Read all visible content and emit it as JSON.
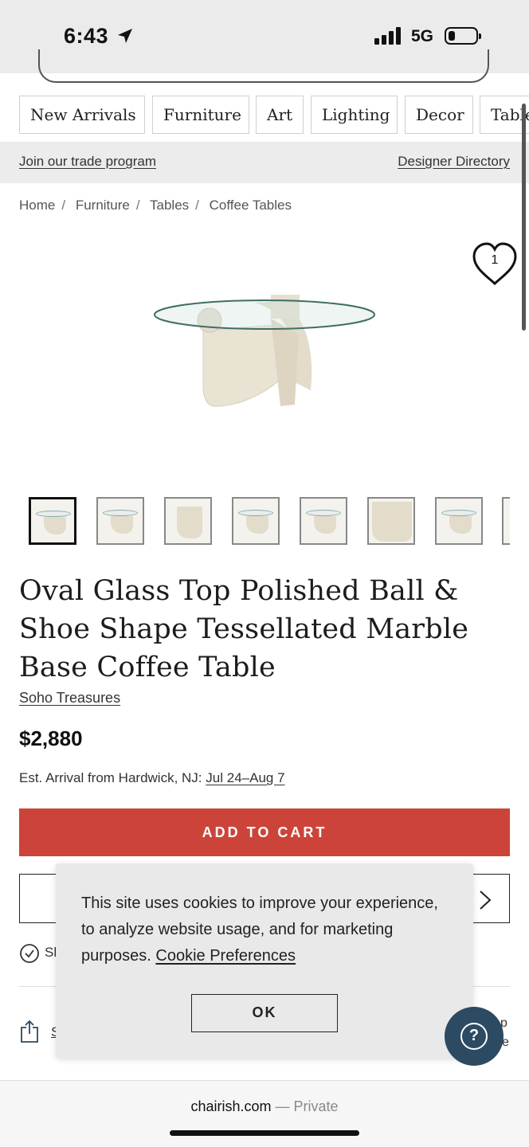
{
  "status_bar": {
    "time": "6:43",
    "network": "5G",
    "battery_fill": 0.2
  },
  "categories": [
    "New Arrivals",
    "Furniture",
    "Art",
    "Lighting",
    "Decor",
    "Tables"
  ],
  "trade_bar": {
    "trade_link": "Join our trade program",
    "designer_link": "Designer Directory"
  },
  "breadcrumb": [
    "Home",
    "Furniture",
    "Tables",
    "Coffee Tables"
  ],
  "favorite": {
    "count": "1",
    "icon": "heart-icon"
  },
  "product": {
    "title": "Oval Glass Top Polished Ball & Shoe Shape Tessellated Marble Base Coffee Table",
    "seller": "Soho Treasures",
    "price": "$2,880",
    "arrival_prefix": "Est. Arrival from Hardwick, NJ:",
    "arrival_dates": "Jul 24–Aug 7",
    "thumbnail_count": 8
  },
  "actions": {
    "add_to_cart": "ADD TO CART",
    "ship_label_fragment": "Sh",
    "share_label_fragment": "S",
    "right_fragment_1": "p",
    "right_fragment_2": "e"
  },
  "cookie_banner": {
    "text": "This site uses cookies to improve your experience, to analyze website usage, and for marketing purposes.",
    "link": "Cookie Preferences",
    "ok": "OK"
  },
  "help": {
    "label": "?"
  },
  "browser": {
    "domain": "chairish.com",
    "privacy": "— Private"
  },
  "colors": {
    "cta": "#cc4439",
    "help_button": "#2c4a62",
    "banner_bg": "#e9e9e9"
  }
}
